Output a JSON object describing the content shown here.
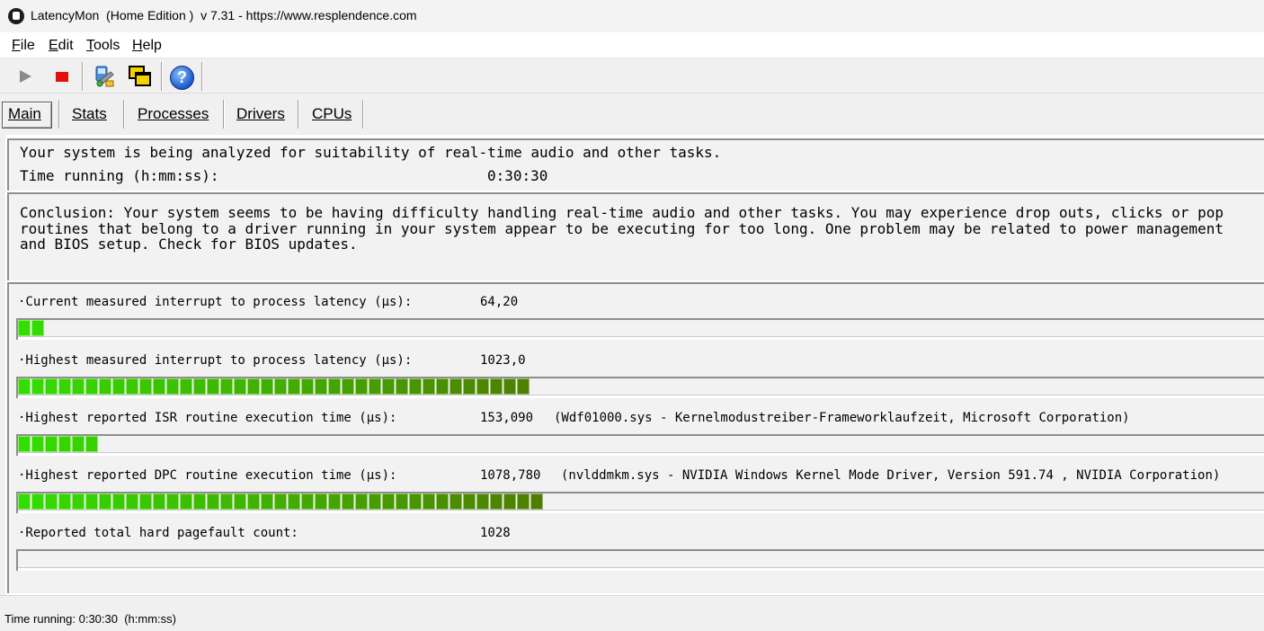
{
  "window": {
    "title": "LatencyMon  (Home Edition )  v 7.31 - https://www.resplendence.com"
  },
  "menu": [
    {
      "first": "F",
      "rest": "ile"
    },
    {
      "first": "E",
      "rest": "dit"
    },
    {
      "first": "T",
      "rest": "ools"
    },
    {
      "first": "H",
      "rest": "elp"
    }
  ],
  "toolbar": {
    "icons": [
      "play-icon",
      "stop-icon",
      "tools-icon",
      "window-icon",
      "help-icon"
    ],
    "help_glyph": "?"
  },
  "tabs": [
    {
      "label": "Main",
      "active": true
    },
    {
      "label": "Stats",
      "active": false
    },
    {
      "label": "Processes",
      "active": false
    },
    {
      "label": "Drivers",
      "active": false
    },
    {
      "label": "CPUs",
      "active": false
    }
  ],
  "analysis": {
    "status": "Your system is being analyzed for suitability of real-time audio and other tasks.",
    "time_label": "Time running (h:mm:ss):",
    "time_value": "0:30:30"
  },
  "conclusion": "Conclusion: Your system seems to be having difficulty handling real-time audio and other tasks. You may experience drop outs, clicks or pop\nroutines that belong to a driver running in your system appear to be executing for too long. One problem may be related to power management\nand BIOS setup. Check for BIOS updates.",
  "metrics": [
    {
      "label": "·Current measured interrupt to process latency (µs):",
      "value": "64,20",
      "detail": "",
      "bar_segments": 2
    },
    {
      "label": "·Highest measured interrupt to process latency (µs):",
      "value": "1023,0",
      "detail": "",
      "bar_segments": 38
    },
    {
      "label": "·Highest reported ISR routine execution time (µs):",
      "value": "153,090",
      "detail": "(Wdf01000.sys - Kernelmodustreiber-Frameworklaufzeit, Microsoft Corporation)",
      "bar_segments": 6
    },
    {
      "label": "·Highest reported DPC routine execution time (µs):",
      "value": "1078,780",
      "detail": "(nvlddmkm.sys - NVIDIA Windows Kernel Mode Driver, Version 591.74 , NVIDIA Corporation)",
      "bar_segments": 39
    },
    {
      "label": "·Reported total hard pagefault count:",
      "value": "1028",
      "detail": "",
      "bar_segments": 0
    }
  ],
  "status_bar": "Time running: 0:30:30  (h:mm:ss)",
  "colors": {
    "bar_green_light": "#33dd00",
    "bar_green_dark": "#4f7c00",
    "panel_bg": "#f2f2f2"
  }
}
